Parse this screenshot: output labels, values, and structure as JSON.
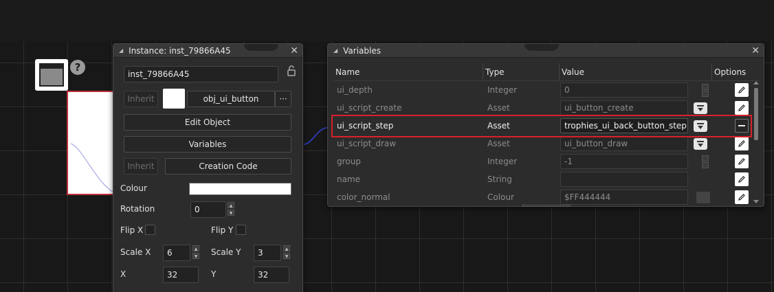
{
  "instance_panel": {
    "title": "Instance: inst_79866A45",
    "close": "✕",
    "instance_name": "inst_79866A45",
    "inherit_label": "Inherit",
    "object_name": "obj_ui_button",
    "object_more": "···",
    "edit_object_label": "Edit Object",
    "variables_label": "Variables",
    "creation_inherit_label": "Inherit",
    "creation_code_label": "Creation Code",
    "colour_label": "Colour",
    "colour_value": "#FFFFFF",
    "rotation_label": "Rotation",
    "rotation_value": "0",
    "flip_x_label": "Flip X",
    "flip_y_label": "Flip Y",
    "scale_x_label": "Scale X",
    "scale_x_value": "6",
    "scale_y_label": "Scale Y",
    "scale_y_value": "3",
    "x_label": "X",
    "x_value": "32",
    "y_label": "Y",
    "y_value": "32"
  },
  "variables_panel": {
    "title": "Variables",
    "close": "✕",
    "columns": [
      "Name",
      "Type",
      "Value",
      "Options"
    ],
    "rows": [
      {
        "name": "ui_depth",
        "type": "Integer",
        "value": "0",
        "control": "spinner"
      },
      {
        "name": "ui_script_create",
        "type": "Asset",
        "value": "ui_button_create",
        "control": "asset-picker"
      },
      {
        "name": "ui_script_step",
        "type": "Asset",
        "value": "trophies_ui_back_button_step",
        "control": "asset-picker",
        "selected": true
      },
      {
        "name": "ui_script_draw",
        "type": "Asset",
        "value": "ui_button_draw",
        "control": "asset-picker"
      },
      {
        "name": "group",
        "type": "Integer",
        "value": "-1",
        "control": "spinner"
      },
      {
        "name": "name",
        "type": "String",
        "value": "",
        "control": "none"
      },
      {
        "name": "color_normal",
        "type": "Colour",
        "value": "$FF444444",
        "control": "swatch"
      }
    ]
  },
  "icons": {
    "instance": "window-icon",
    "help": "?",
    "lock": "lock-icon",
    "edit": "pencil-icon",
    "remove": "minus-icon"
  },
  "colors": {
    "highlight": "#D9202C",
    "selection_outline": "#C0303A"
  }
}
